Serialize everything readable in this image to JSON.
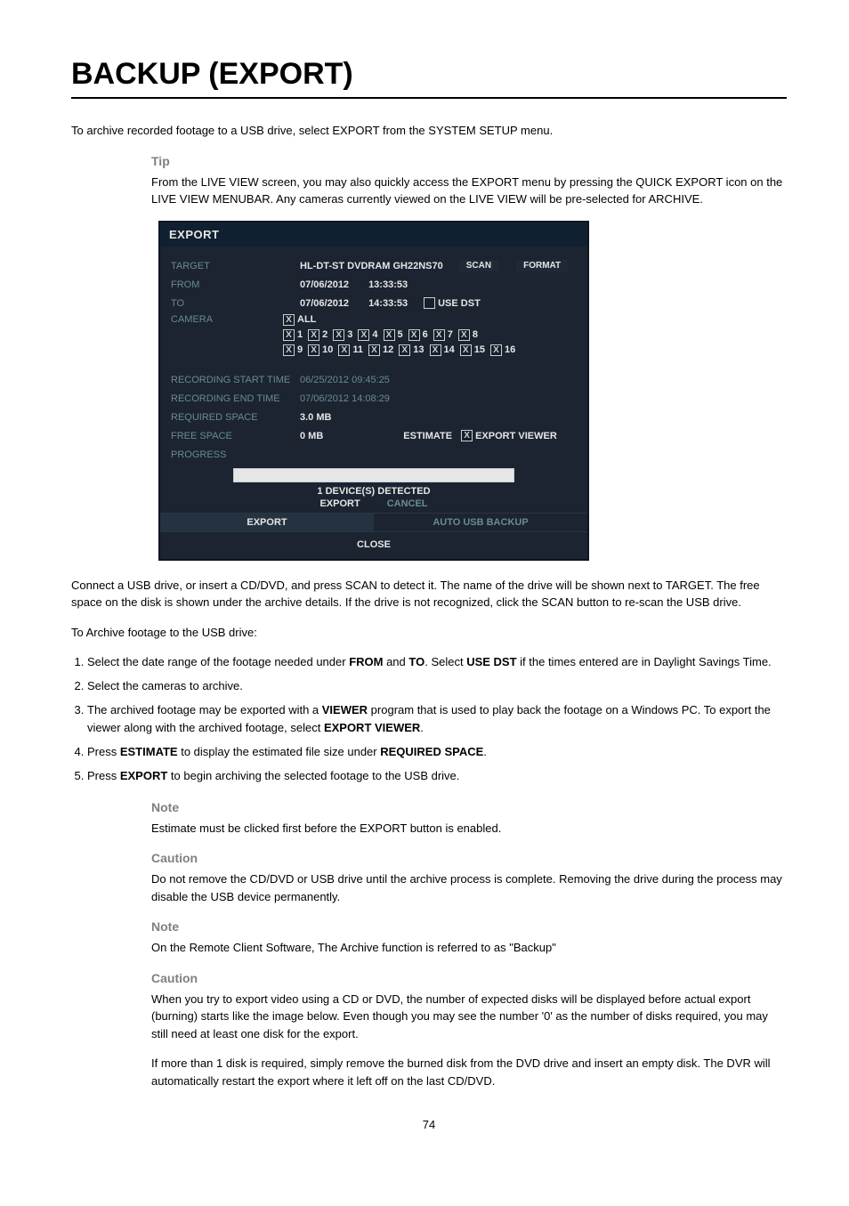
{
  "heading": "BACKUP (EXPORT)",
  "intro1": "To archive recorded footage to a USB drive, select EXPORT from the SYSTEM SETUP menu.",
  "tip_label": "Tip",
  "tip_text": "From the LIVE VIEW screen, you may also quickly access the EXPORT menu by pressing the QUICK EXPORT icon on the LIVE VIEW MENUBAR. Any cameras currently viewed on the LIVE VIEW will be pre-selected for ARCHIVE.",
  "dialog": {
    "title": "EXPORT",
    "target_label": "TARGET",
    "target_value": "HL-DT-ST DVDRAM GH22NS70",
    "scan_btn": "SCAN",
    "format_btn": "FORMAT",
    "from_label": "FROM",
    "from_date": "07/06/2012",
    "from_time": "13:33:53",
    "to_label": "TO",
    "to_date": "07/06/2012",
    "to_time": "14:33:53",
    "use_dst": "USE DST",
    "camera_label": "CAMERA",
    "all_label": "ALL",
    "cams_a": [
      "1",
      "2",
      "3",
      "4",
      "5",
      "6",
      "7",
      "8"
    ],
    "cams_b": [
      "9",
      "10",
      "11",
      "12",
      "13",
      "14",
      "15",
      "16"
    ],
    "rec_start_label": "RECORDING START TIME",
    "rec_start_val": "06/25/2012 09:45:25",
    "rec_end_label": "RECORDING END TIME",
    "rec_end_val": "07/06/2012 14:08:29",
    "req_space_label": "REQUIRED SPACE",
    "req_space_val": "3.0 MB",
    "free_space_label": "FREE SPACE",
    "free_space_val": "0 MB",
    "estimate_btn": "ESTIMATE",
    "export_viewer": "EXPORT VIEWER",
    "progress_label": "PROGRESS",
    "devices": "1 DEVICE(S) DETECTED",
    "export_btn": "EXPORT",
    "cancel_btn": "CANCEL",
    "tab_export": "EXPORT",
    "tab_autousb": "AUTO USB BACKUP",
    "close_btn": "CLOSE"
  },
  "after_dialog": "Connect a USB drive, or insert a CD/DVD, and press SCAN to detect it. The name of the drive will be shown next to TARGET. The free space on the disk is shown under the archive details. If the drive is not recognized, click the SCAN button to re-scan the USB drive.",
  "archive_intro": "To Archive footage to the USB drive:",
  "steps": [
    {
      "num": "1.",
      "text_a": "Select the date range of the footage needed under ",
      "b1": "FROM",
      "mid": " and ",
      "b2": "TO",
      "text_b": ". Select ",
      "b3": "USE DST",
      "tail": " if the times entered are in Daylight Savings Time."
    },
    {
      "num": "2.",
      "text": "Select the cameras to archive."
    },
    {
      "num": "3.",
      "text_a": "The archived footage may be exported with a ",
      "b1": "VIEWER",
      "mid": " program that is used to play back the footage on a Windows PC. To export the viewer along with the archived footage, select ",
      "b2": "EXPORT VIEWER",
      "tail": "."
    },
    {
      "num": "4.",
      "text_a": "Press ",
      "b1": "ESTIMATE",
      "mid": " to display the estimated file size under ",
      "b2": "REQUIRED SPACE",
      "tail": "."
    },
    {
      "num": "5.",
      "text_a": "Press ",
      "b1": "EXPORT",
      "tail": " to begin archiving the selected footage to the USB drive."
    }
  ],
  "note1_label": "Note",
  "note1_text": "Estimate must be clicked first before the EXPORT button is enabled.",
  "caution1_label": "Caution",
  "caution1_text": "Do not remove the CD/DVD or USB drive until the archive process is complete. Removing the drive during the process may disable the USB device permanently.",
  "note2_label": "Note",
  "note2_text": "On the Remote Client Software, The Archive function is referred to as \"Backup\"",
  "caution2_label": "Caution",
  "caution2_text1": "When you try to export video using a CD or DVD, the number of expected disks will be displayed before actual export (burning) starts like the image below. Even though you may see the number '0' as the number of disks required, you may still need at least one disk for the export.",
  "caution2_text2": "If more than 1 disk is required, simply remove the burned disk from the DVD drive and insert an empty disk. The DVR will automatically restart the export where it left off on the last CD/DVD.",
  "page_num": "74"
}
